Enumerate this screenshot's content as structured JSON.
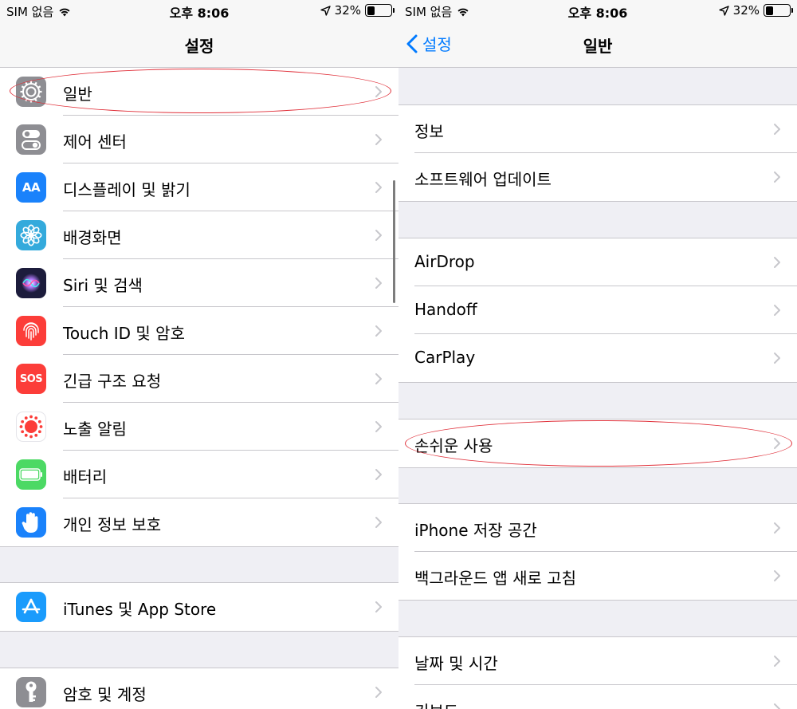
{
  "left": {
    "status": {
      "carrier": "SIM 없음",
      "time": "오후 8:06",
      "battery": "32%",
      "battery_level": 0.32
    },
    "nav_title": "설정",
    "groups": [
      [
        {
          "label": "일반",
          "icon": "gear-icon",
          "color": "#8e8e93"
        },
        {
          "label": "제어 센터",
          "icon": "toggles-icon",
          "color": "#8e8e93"
        },
        {
          "label": "디스플레이 및 밝기",
          "icon": "text-size-icon",
          "color": "#1a82fb",
          "icon_text": "AA"
        },
        {
          "label": "배경화면",
          "icon": "flower-icon",
          "color": "#34aadc"
        },
        {
          "label": "Siri 및 검색",
          "icon": "siri-icon",
          "color": "#1c1c3c"
        },
        {
          "label": "Touch ID 및 암호",
          "icon": "fingerprint-icon",
          "color": "#fc3d39"
        },
        {
          "label": "긴급 구조 요청",
          "icon": "sos-icon",
          "color": "#fc3d39",
          "icon_text": "SOS"
        },
        {
          "label": "노출 알림",
          "icon": "exposure-icon",
          "color": "#ffffff"
        },
        {
          "label": "배터리",
          "icon": "battery-icon",
          "color": "#4cd964"
        },
        {
          "label": "개인 정보 보호",
          "icon": "hand-icon",
          "color": "#1a82fb"
        }
      ],
      [
        {
          "label": "iTunes 및 App Store",
          "icon": "app-store-icon",
          "color": "#1a9bfc"
        }
      ],
      [
        {
          "label": "암호 및 계정",
          "icon": "key-icon",
          "color": "#8e8e93"
        }
      ]
    ]
  },
  "right": {
    "status": {
      "carrier": "SIM 없음",
      "time": "오후 8:06",
      "battery": "32%",
      "battery_level": 0.32
    },
    "nav_title": "일반",
    "back_label": "설정",
    "groups": [
      [
        {
          "label": "정보"
        },
        {
          "label": "소프트웨어 업데이트"
        }
      ],
      [
        {
          "label": "AirDrop"
        },
        {
          "label": "Handoff"
        },
        {
          "label": "CarPlay"
        }
      ],
      [
        {
          "label": "손쉬운 사용"
        }
      ],
      [
        {
          "label": "iPhone 저장 공간"
        },
        {
          "label": "백그라운드 앱 새로 고침"
        }
      ],
      [
        {
          "label": "날짜 및 시간"
        },
        {
          "label": "키보드"
        }
      ]
    ]
  },
  "colors": {
    "accent": "#007aff",
    "highlight": "#e0303a",
    "separator": "#c8c7cc",
    "chevron": "#c7c7cc"
  }
}
